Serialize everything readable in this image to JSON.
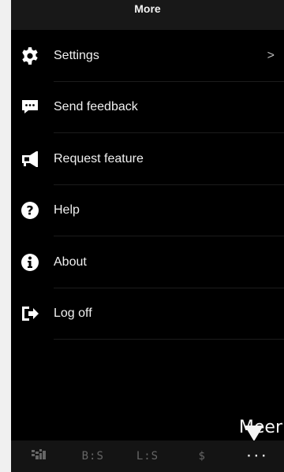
{
  "header": {
    "title": "More"
  },
  "menu": {
    "items": [
      {
        "label": "Settings",
        "icon": "gear-icon",
        "has_chevron": true
      },
      {
        "label": "Send feedback",
        "icon": "chat-bubble-icon"
      },
      {
        "label": "Request feature",
        "icon": "megaphone-icon"
      },
      {
        "label": "Help",
        "icon": "question-circle-icon"
      },
      {
        "label": "About",
        "icon": "info-circle-icon"
      },
      {
        "label": "Log off",
        "icon": "sign-out-icon"
      }
    ],
    "chevron": ">"
  },
  "annotation": {
    "text": "Meer"
  },
  "tabbar": {
    "tabs": [
      {
        "label": "",
        "icon": "grid-logo-icon"
      },
      {
        "label": "B:S"
      },
      {
        "label": "L:S"
      },
      {
        "label": "$"
      },
      {
        "label": "···",
        "active": true
      }
    ]
  },
  "colors": {
    "background": "#000000",
    "header": "#181818",
    "text": "#f0f0f0",
    "tab_inactive": "#666666",
    "tab_active": "#e8e8e8"
  }
}
